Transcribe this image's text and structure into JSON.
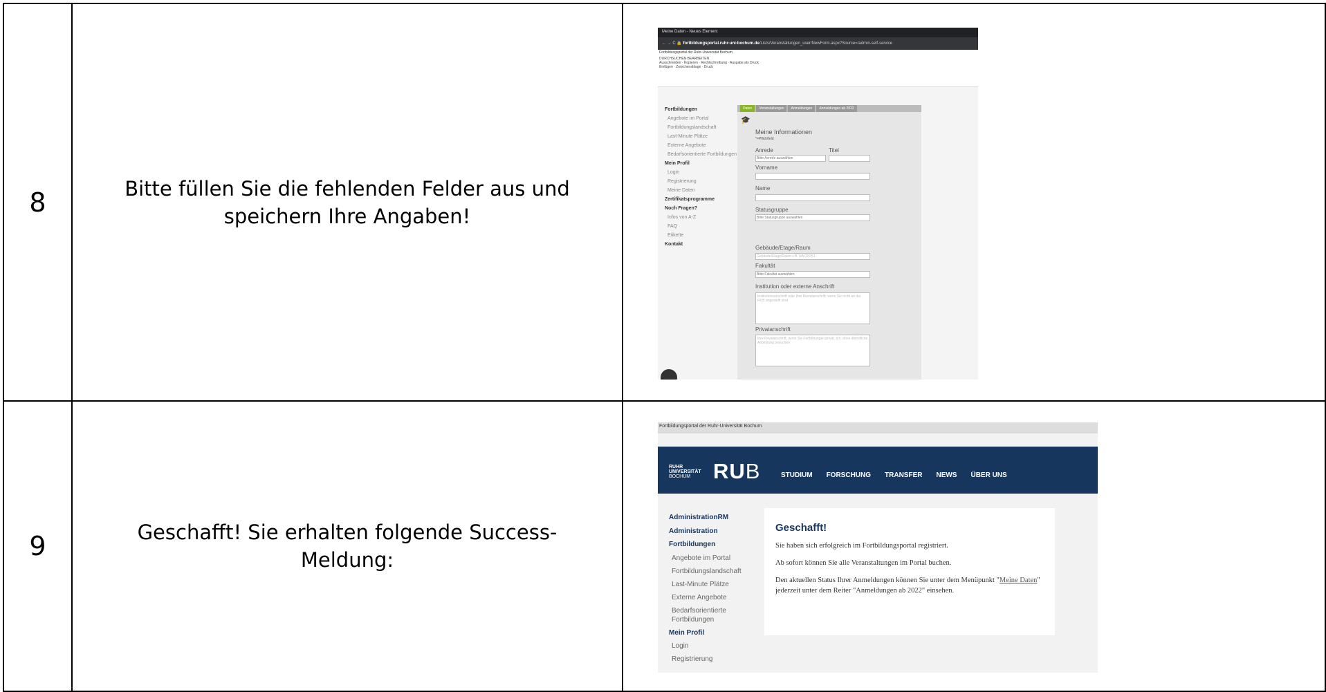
{
  "rows": [
    {
      "number": "8",
      "instruction": "Bitte füllen Sie die fehlenden Felder aus und speichern Ihre Angaben!"
    },
    {
      "number": "9",
      "instruction": "Geschafft! Sie erhalten folgende Success-Meldung:"
    }
  ],
  "shot8": {
    "tab_title": "Meine Daten - Neues Element",
    "url_bold": "fortbildungsportal.ruhr-uni-bochum.de",
    "url_rest": "/Lists/Veranstaltungen_user/NewForm.aspx?Source=/admin-self-service",
    "site_header": "Fortbildungsportal der Ruhr-Universität Bochum",
    "ribbon": [
      "DURCHSUCHEN",
      "BEARBEITEN",
      "Ausschneiden",
      "Kopieren",
      "Rechtschreibung",
      "Einfügen",
      "Zwischenablage",
      "Ausgabe als Druck",
      "Druck"
    ],
    "nav": [
      {
        "label": "Fortbildungen",
        "type": "b"
      },
      {
        "label": "Angebote im Portal",
        "type": "s"
      },
      {
        "label": "Fortbildungslandschaft",
        "type": "s"
      },
      {
        "label": "Last-Minute Plätze",
        "type": "s"
      },
      {
        "label": "Externe Angebote",
        "type": "s"
      },
      {
        "label": "Bedarfsorientierte Fortbildungen",
        "type": "s"
      },
      {
        "label": "Mein Profil",
        "type": "b"
      },
      {
        "label": "Login",
        "type": "s"
      },
      {
        "label": "Registrierung",
        "type": "s"
      },
      {
        "label": "Meine Daten",
        "type": "s"
      },
      {
        "label": "Zertifikatsprogramme",
        "type": "b"
      },
      {
        "label": "Noch Fragen?",
        "type": "b"
      },
      {
        "label": "Infos von A-Z",
        "type": "s"
      },
      {
        "label": "FAQ",
        "type": "s"
      },
      {
        "label": "Etikette",
        "type": "s"
      },
      {
        "label": "Kontakt",
        "type": "b"
      }
    ],
    "form_tabs": [
      "Daten",
      "Veranstaltungen",
      "Anmeldungen",
      "Anmeldungen ab 2022"
    ],
    "heading": "Meine Informationen",
    "required_note": "*=Pflichtfeld",
    "labels": {
      "anrede": "Anrede",
      "titel": "Titel",
      "vorname": "Vorname",
      "name": "Name",
      "statusgruppe": "Statusgruppe",
      "gebaeude": "Gebäude/Etage/Raum",
      "fakultaet": "Fakultät",
      "institution": "Institution oder externe Anschrift",
      "privat": "Privatanschrift"
    },
    "values": {
      "anrede": "Bitte Anrede auswählen",
      "statusgruppe": "Bitte Statusgruppe auswählen",
      "gebaeude_placeholder": "Gebäude/Etage/Raum z.B. NA 02/251",
      "fakultaet": "Bitte Fakultät auswählen",
      "institution_placeholder": "Institutionsanschrift oder Ihre Dienstanschrift, wenn Sie nicht an der RUB angestellt sind",
      "privat_placeholder": "Ihre Privatanschrift, wenn Sie Fortbildungen privat, d.h. ohne dienstliche Anbindung besuchen"
    }
  },
  "shot9": {
    "site_header": "Fortbildungsportal der Ruhr-Universität Bochum",
    "logo_small": [
      "RUHR",
      "UNIVERSITÄT",
      "BOCHUM"
    ],
    "logo_big_a": "RU",
    "logo_big_b": "B",
    "topnav": [
      "STUDIUM",
      "FORSCHUNG",
      "TRANSFER",
      "NEWS",
      "ÜBER UNS"
    ],
    "nav": [
      {
        "label": "AdministrationRM",
        "type": "b"
      },
      {
        "label": "Administration",
        "type": "b"
      },
      {
        "label": "Fortbildungen",
        "type": "b"
      },
      {
        "label": "Angebote im Portal",
        "type": "s"
      },
      {
        "label": "Fortbildungslandschaft",
        "type": "s"
      },
      {
        "label": "Last-Minute Plätze",
        "type": "s"
      },
      {
        "label": "Externe Angebote",
        "type": "s"
      },
      {
        "label": "Bedarfsorientierte Fortbildungen",
        "type": "s"
      },
      {
        "label": "Mein Profil",
        "type": "b"
      },
      {
        "label": "Login",
        "type": "s"
      },
      {
        "label": "Registrierung",
        "type": "s"
      }
    ],
    "card_title": "Geschafft!",
    "p1": "Sie haben sich erfolgreich im Fortbildungsportal registriert.",
    "p2": "Ab sofort können Sie alle Veranstaltungen im Portal buchen.",
    "p3a": "Den aktuellen Status Ihrer Anmeldungen können Sie unter dem Menüpunkt \"",
    "p3link": "Meine Daten",
    "p3b": "\" jederzeit unter dem Reiter \"Anmeldungen ab 2022\" einsehen."
  }
}
